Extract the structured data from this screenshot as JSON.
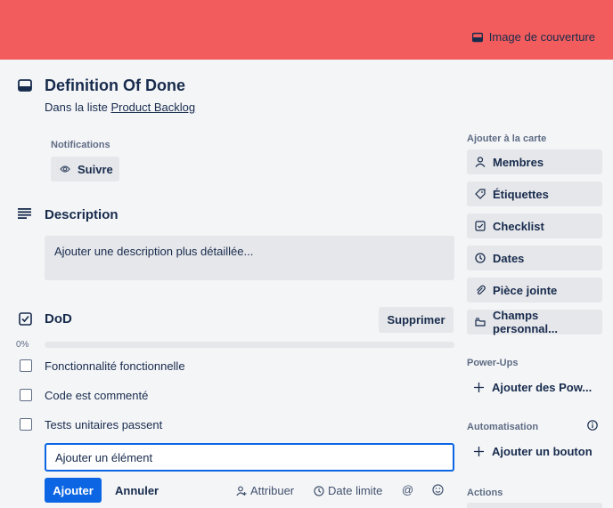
{
  "cover": {
    "button_label": "Image de couverture",
    "color": "#f25c5c"
  },
  "card": {
    "title": "Definition Of Done",
    "list_prefix": "Dans la liste",
    "list_name": "Product Backlog",
    "icon": "card-icon"
  },
  "notifications": {
    "label": "Notifications",
    "follow_label": "Suivre"
  },
  "description": {
    "heading": "Description",
    "placeholder": "Ajouter une description plus détaillée..."
  },
  "checklist": {
    "heading": "DoD",
    "delete_label": "Supprimer",
    "progress_label": "0%",
    "progress": 0,
    "items": [
      {
        "label": "Fonctionnalité fonctionnelle",
        "checked": false
      },
      {
        "label": "Code est commenté",
        "checked": false
      },
      {
        "label": "Tests unitaires passent",
        "checked": false
      }
    ],
    "add_input_value": "Ajouter un élément",
    "add_button": "Ajouter",
    "cancel_button": "Annuler",
    "assign_label": "Attribuer",
    "due_label": "Date limite"
  },
  "sidebar": {
    "add_to_card_label": "Ajouter à la carte",
    "buttons": [
      {
        "label": "Membres",
        "icon": "person-icon"
      },
      {
        "label": "Étiquettes",
        "icon": "tag-icon"
      },
      {
        "label": "Checklist",
        "icon": "checklist-icon"
      },
      {
        "label": "Dates",
        "icon": "clock-icon"
      },
      {
        "label": "Pièce jointe",
        "icon": "paperclip-icon"
      },
      {
        "label": "Champs personnal...",
        "icon": "custom-fields-icon"
      }
    ],
    "powerups_label": "Power-Ups",
    "add_powerups": "Ajouter des Pow...",
    "automation_label": "Automatisation",
    "add_button_label": "Ajouter un bouton",
    "actions_label": "Actions"
  },
  "colors": {
    "primary": "#0c66e4",
    "button_grey": "#e6e7ea",
    "background": "#f4f5f7"
  }
}
